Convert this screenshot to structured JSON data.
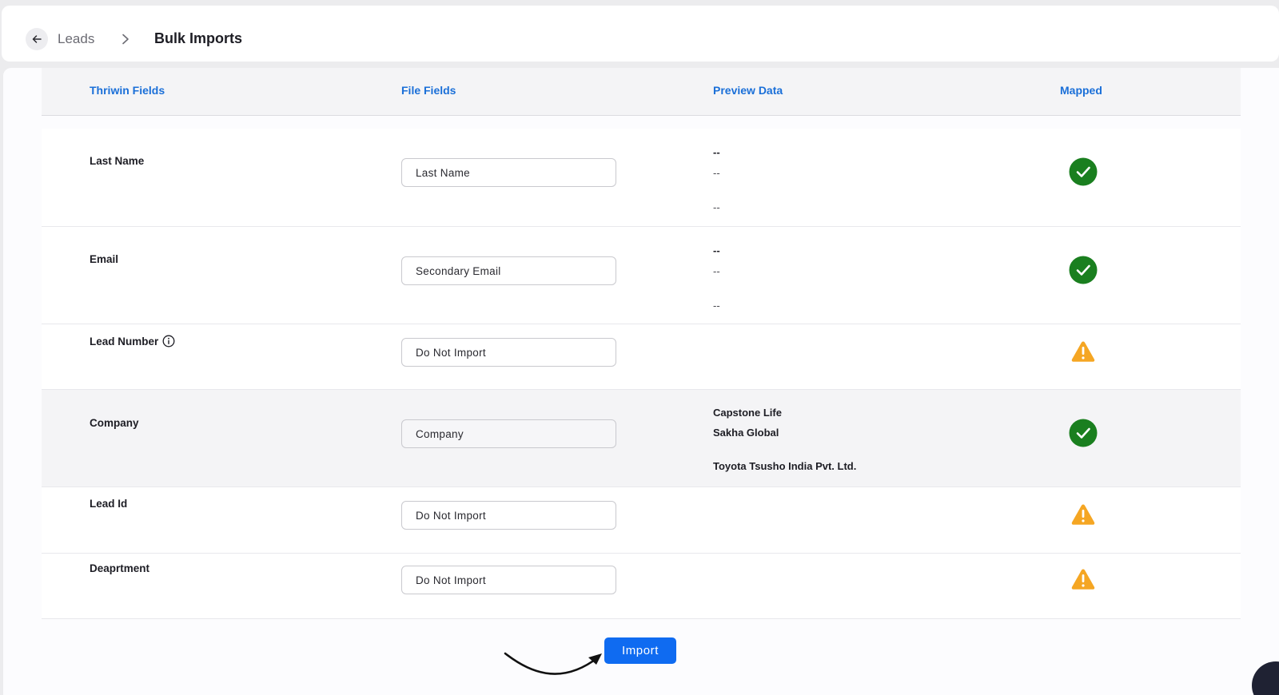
{
  "breadcrumb": {
    "parent": "Leads",
    "current": "Bulk Imports"
  },
  "table": {
    "headers": {
      "thriwin_fields": "Thriwin Fields",
      "file_fields": "File Fields",
      "preview_data": "Preview Data",
      "mapped": "Mapped"
    },
    "rows": [
      {
        "label": "Last Name",
        "field": "Last Name",
        "preview": [
          "--",
          "--",
          "--"
        ],
        "mapped": "success",
        "info": false,
        "highlighted": false
      },
      {
        "label": "Email",
        "field": "Secondary Email",
        "preview": [
          "--",
          "--",
          "--"
        ],
        "mapped": "success",
        "info": false,
        "highlighted": false
      },
      {
        "label": "Lead Number",
        "field": "Do Not Import",
        "preview": [],
        "mapped": "warning",
        "info": true,
        "highlighted": false
      },
      {
        "label": "Company",
        "field": "Company",
        "preview": [
          "Capstone Life",
          "Sakha Global",
          "Toyota Tsusho India Pvt. Ltd."
        ],
        "mapped": "success",
        "info": false,
        "highlighted": true
      },
      {
        "label": "Lead Id",
        "field": "Do Not Import",
        "preview": [],
        "mapped": "warning",
        "info": false,
        "highlighted": false
      },
      {
        "label": "Deaprtment",
        "field": "Do Not Import",
        "preview": [],
        "mapped": "warning",
        "info": false,
        "highlighted": false
      }
    ]
  },
  "actions": {
    "import_label": "Import"
  },
  "colors": {
    "accent": "#0f6bf1",
    "header_text": "#1a6fd8",
    "success": "#1a7f1f",
    "warning": "#f5a623"
  },
  "icons": {
    "back": "arrow-left-icon",
    "separator": "chevron-right-icon",
    "info": "info-icon",
    "success": "check-circle-icon",
    "warning": "warning-triangle-icon",
    "chat": "chat-icon"
  }
}
